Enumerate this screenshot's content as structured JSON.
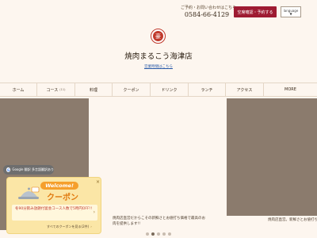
{
  "header": {
    "contact_label": "ご予約・お問い合わせはこちら",
    "phone": "0584-66-4129",
    "reserve_button": "空席確認・予約する",
    "language_label": "language",
    "language_caret": "▼"
  },
  "logo": {
    "glyph": "豪"
  },
  "shop": {
    "name": "焼肉まるこう海津店",
    "hours_link": "営業時間はこちら"
  },
  "nav": {
    "items": [
      {
        "label": "ホーム",
        "count": ""
      },
      {
        "label": "コース",
        "count": "(11)"
      },
      {
        "label": "料理",
        "count": ""
      },
      {
        "label": "クーポン",
        "count": ""
      },
      {
        "label": "ドリンク",
        "count": ""
      },
      {
        "label": "ランチ",
        "count": ""
      },
      {
        "label": "アクセス",
        "count": ""
      },
      {
        "label": "MORE",
        "count": ""
      }
    ]
  },
  "hero": {
    "caption_center": "焼肉店直営だからこその新鮮さとお値打ち価格で最高のお肉を提供します!!",
    "caption_right": "焼肉店直営。新鮮さとお値打ちの",
    "active_slide": 1,
    "slide_count": 5
  },
  "translate": {
    "label": "Google 翻訳 多言語翻訳あり",
    "icon": "G"
  },
  "coupon": {
    "close": "×",
    "welcome": "Welcome!",
    "title": "クーポン",
    "description": "冬90分飲み放題付宴会コース人数で5時円OFF!!",
    "more_link": "すべてのクーポンを見る(2件)",
    "arrow": "›"
  },
  "colors": {
    "accent": "#9e1b32",
    "coupon_bg": "#fbe6a6",
    "coupon_orange": "#e07b10"
  }
}
